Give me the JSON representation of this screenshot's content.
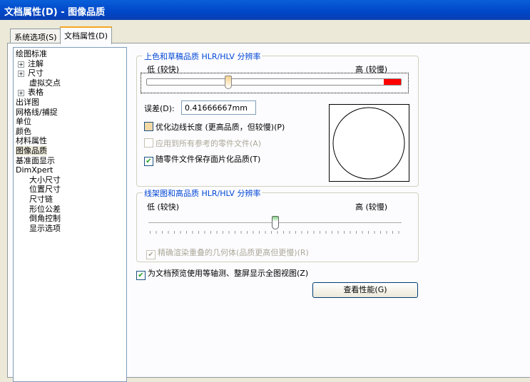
{
  "window": {
    "title": "文档属性(D) - 图像品质"
  },
  "tabs": [
    {
      "label": "系统选项(S)",
      "active": false
    },
    {
      "label": "文档属性(D)",
      "active": true
    }
  ],
  "tree": [
    {
      "label": "绘图标准",
      "level": 0,
      "expander": ""
    },
    {
      "label": "注解",
      "level": 1,
      "expander": "+"
    },
    {
      "label": "尺寸",
      "level": 1,
      "expander": "+"
    },
    {
      "label": "虚拟交点",
      "level": 1,
      "expander": ""
    },
    {
      "label": "表格",
      "level": 1,
      "expander": "+"
    },
    {
      "label": "出详图",
      "level": 0,
      "expander": ""
    },
    {
      "label": "网格线/捕捉",
      "level": 0,
      "expander": ""
    },
    {
      "label": "单位",
      "level": 0,
      "expander": ""
    },
    {
      "label": "颜色",
      "level": 0,
      "expander": ""
    },
    {
      "label": "材料属性",
      "level": 0,
      "expander": ""
    },
    {
      "label": "图像品质",
      "level": 0,
      "expander": "",
      "selected": true
    },
    {
      "label": "基准面显示",
      "level": 0,
      "expander": ""
    },
    {
      "label": "DimXpert",
      "level": 0,
      "expander": ""
    },
    {
      "label": "大小尺寸",
      "level": 1,
      "expander": ""
    },
    {
      "label": "位置尺寸",
      "level": 1,
      "expander": ""
    },
    {
      "label": "尺寸链",
      "level": 1,
      "expander": ""
    },
    {
      "label": "形位公差",
      "level": 1,
      "expander": ""
    },
    {
      "label": "倒角控制",
      "level": 1,
      "expander": ""
    },
    {
      "label": "显示选项",
      "level": 1,
      "expander": ""
    }
  ],
  "shaded": {
    "title": "上色和草稿品质 HLR/HLV 分辨率",
    "low": "低 (较快)",
    "high": "高 (较慢)",
    "slider_percent": 32,
    "deviation_label": "误差(D):",
    "deviation_value": "0.41666667mm",
    "optimize_label": "优化边线长度 (更高品质，但较慢)(P)",
    "optimize_checked": false,
    "apply_label": "应用到所有参考的零件文件(A)",
    "apply_checked": false,
    "save_label": "随零件文件保存面片化品质(T)",
    "save_checked": true
  },
  "wireframe": {
    "title": "线架图和高品质 HLR/HLV 分辨率",
    "low": "低 (较快)",
    "high": "高 (较慢)",
    "slider_percent": 50,
    "precise_label": "精确渲染重叠的几何体(品质更高但更慢)(R)",
    "precise_checked": true
  },
  "preview_label": "为文档预览使用等轴测、整屏显示全图视图(Z)",
  "preview_checked": true,
  "perf_button": "查看性能(G)",
  "colors": {
    "red_zone": "#ff0000",
    "legend": "#0046d5"
  }
}
